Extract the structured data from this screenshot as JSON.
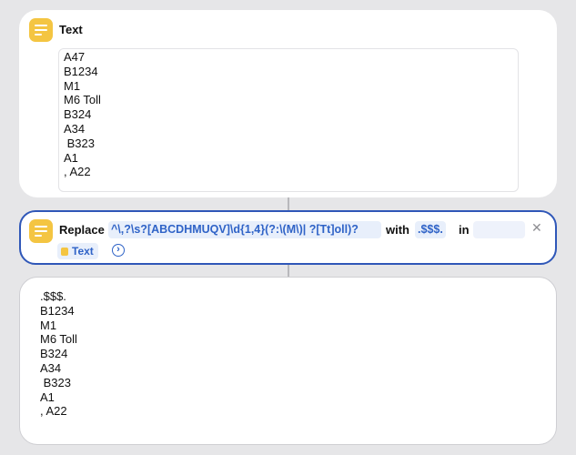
{
  "text_action": {
    "title": "Text",
    "lines": [
      "A47",
      "B1234",
      "M1",
      "M6 Toll",
      "B324",
      "A34",
      " B323",
      "A1",
      ", A22"
    ]
  },
  "replace_action": {
    "verb": "Replace",
    "pattern": "^\\,?\\s?[ABCDHMUQV]\\d{1,4}(?:\\(M\\)| ?[Tt]oll)?",
    "with_label": "with",
    "replacement": ".$$$.",
    "in_label": "in",
    "variable": "Text",
    "clear_icon": "x-icon",
    "expand_icon": "chevron-right-circle-icon"
  },
  "output": {
    "lines": [
      ".$$$.",
      "B1234",
      "M1",
      "M6 Toll",
      "B324",
      "A34",
      " B323",
      "A1",
      ", A22"
    ]
  },
  "colors": {
    "accent": "#2f57b8",
    "token_bg": "#e8effb",
    "token_text": "#2f63c7",
    "icon_yellow": "#f4c542",
    "background": "#e6e6e8"
  }
}
